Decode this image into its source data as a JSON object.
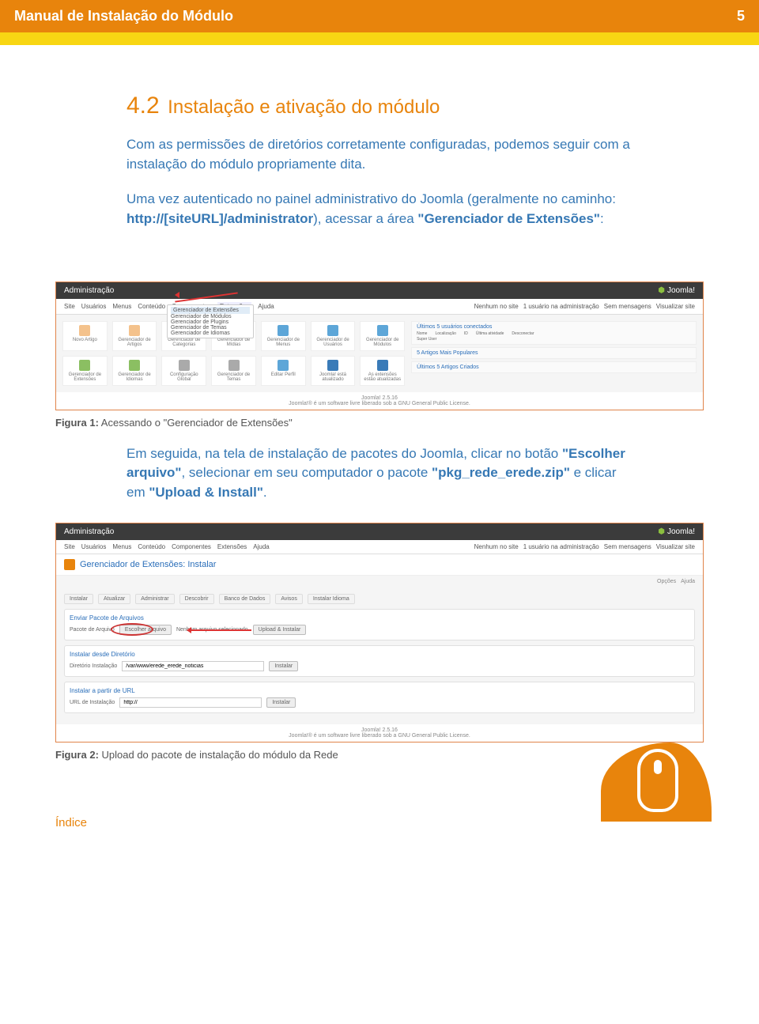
{
  "header": {
    "title": "Manual de Instalação do Módulo",
    "page_number": "5"
  },
  "section": {
    "number": "4.2",
    "title": "Instalação e ativação do módulo"
  },
  "para1": "Com as permissões de diretórios corretamente configuradas, podemos seguir com a instalação do módulo propriamente dita.",
  "para2_pre": "Uma vez autenticado no painel administrativo do Joomla (geralmente no caminho: ",
  "para2_bold1": "http://[siteURL]/administrator",
  "para2_mid": "), acessar a área ",
  "para2_bold2": "\"Gerenciador de Extensões\"",
  "para2_end": ":",
  "fig1": {
    "label": "Figura 1:",
    "text": " Acessando o \"Gerenciador de Extensões\""
  },
  "para3_pre": "Em seguida, na tela de instalação de pacotes do Joomla, clicar no botão ",
  "para3_b1": "\"Escolher arquivo\"",
  "para3_mid": ", selecionar em seu computador o pacote ",
  "para3_b2": "\"pkg_rede_erede.zip\"",
  "para3_mid2": " e clicar em ",
  "para3_b3": "\"Upload & Install\"",
  "para3_end": ".",
  "fig2": {
    "label": "Figura 2:",
    "text": " Upload do pacote de instalação do módulo da Rede"
  },
  "footer_link": "Índice",
  "ss1": {
    "admin": "Administração",
    "brand": "Joomla!",
    "menu": [
      "Site",
      "Usuários",
      "Menus",
      "Conteúdo",
      "Componentes",
      "Extensões",
      "Ajuda"
    ],
    "dropdown": [
      "Gerenciador de Extensões",
      "Gerenciador de Módulos",
      "Gerenciador de Plugins",
      "Gerenciador de Temas",
      "Gerenciador de Idiomas"
    ],
    "right": [
      "Nenhum no site",
      "1 usuário na administração",
      "Sem mensagens",
      "Visualizar site"
    ],
    "tiles": [
      "Novo Artigo",
      "Gerenciador de Artigos",
      "Gerenciador de Categorias",
      "Gerenciador de Mídias",
      "Gerenciador de Menus",
      "Gerenciador de Usuários",
      "Gerenciador de Módulos",
      "Gerenciador de Extensões",
      "Gerenciador de Idiomas",
      "Configuração Global",
      "Gerenciador de Temas",
      "Editar Perfil",
      "Joomla! está atualizado",
      "As extensões estão atualizadas"
    ],
    "side_heads": [
      "Últimos 5 usuários conectados",
      "5 Artigos Mais Populares",
      "Últimos 5 Artigos Criados"
    ],
    "side_cols": [
      "Nome",
      "Localização",
      "ID",
      "Última atividade",
      "Desconectar"
    ],
    "side_user": "Super User",
    "footer": "Joomla! 2.5.16",
    "footer2": "Joomla!® é um software livre liberado sob a GNU General Public License."
  },
  "ss2": {
    "admin": "Administração",
    "brand": "Joomla!",
    "title": "Gerenciador de Extensões: Instalar",
    "ops": [
      "Opções",
      "Ajuda"
    ],
    "tabs": [
      "Instalar",
      "Atualizar",
      "Administrar",
      "Descobrir",
      "Banco de Dados",
      "Avisos",
      "Instalar Idioma"
    ],
    "g1": "Enviar Pacote de Arquivos",
    "g1_label": "Pacote de Arquivo",
    "g1_btn": "Escolher arquivo",
    "g1_none": "Nenhum arquivo selecionado",
    "g1_submit": "Upload & Instalar",
    "g2": "Instalar desde Diretório",
    "g2_label": "Diretório Instalação",
    "g2_val": "/var/www/erede_erede_noticias",
    "g2_btn": "Instalar",
    "g3": "Instalar a partir de URL",
    "g3_label": "URL de Instalação",
    "g3_val": "http://",
    "g3_btn": "Instalar",
    "footer": "Joomla! 2.5.16",
    "footer2": "Joomla!® é um software livre liberado sob a GNU General Public License."
  }
}
